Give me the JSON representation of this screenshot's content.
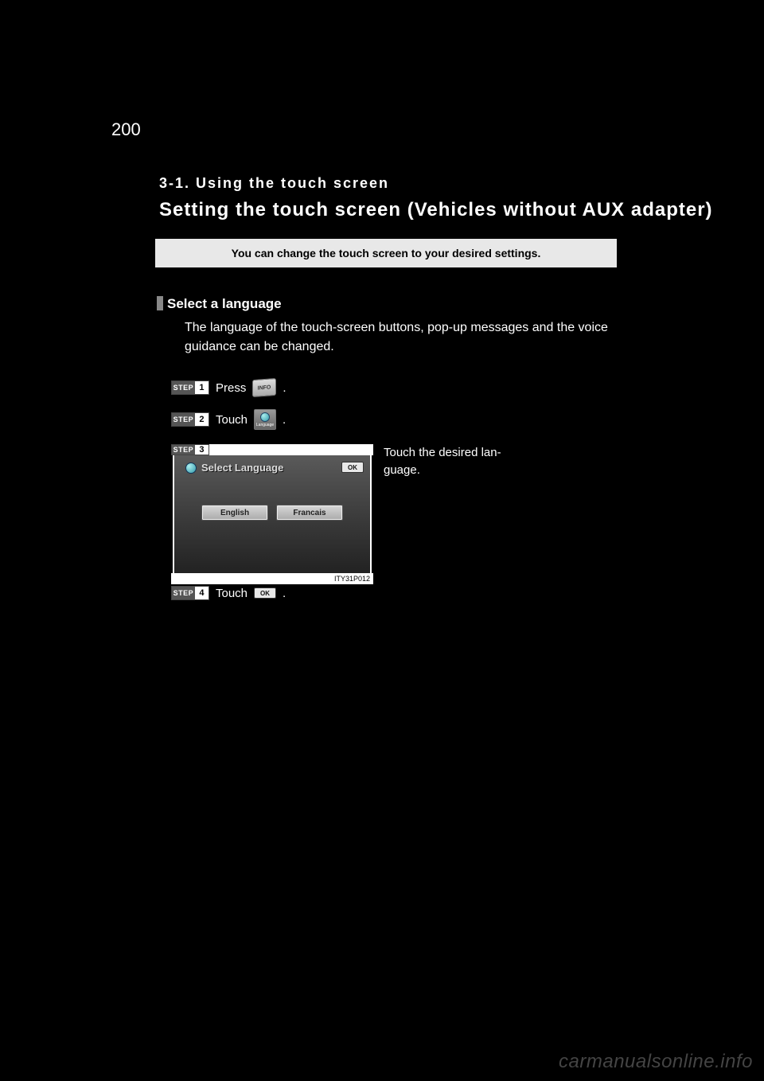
{
  "page_number": "200",
  "section_label": "3-1. Using the touch screen",
  "section_title": "Setting the touch screen (Vehicles without AUX adapter)",
  "info_bar": "You can change the touch screen to your desired settings.",
  "subhead": "Select a language",
  "body_text": "The language of the touch-screen buttons, pop-up messages and the voice guidance can be changed.",
  "steps": {
    "label": "STEP",
    "s1": {
      "num": "1",
      "text_before": "Press",
      "text_after": "."
    },
    "s2": {
      "num": "2",
      "text_before": "Touch",
      "text_after": "."
    },
    "s3": {
      "num": "3",
      "side_a": "Touch   the   desired   lan-",
      "side_b": "guage."
    },
    "s4": {
      "num": "4",
      "text_before": "Touch",
      "text_after": "."
    }
  },
  "buttons": {
    "info": "INFO",
    "language": "Language",
    "ok": "OK"
  },
  "screen": {
    "title": "Select Language",
    "ok": "OK",
    "english": "English",
    "francais": "Francais",
    "caption": "ITY31P012"
  },
  "watermark": "carmanualsonline.info"
}
